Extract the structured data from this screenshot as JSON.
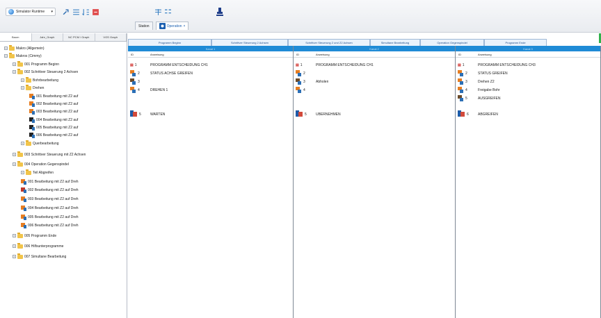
{
  "toolbar": {
    "dropdown_label": "Simulator Runtime",
    "top_tabs": [
      {
        "label": "Station",
        "active": false
      },
      {
        "label": "Operation",
        "active": true
      }
    ]
  },
  "left_panel": {
    "tabs": [
      "Baum",
      "Jahr_Graph",
      "NC PCM / Graph",
      "VGS Graph"
    ],
    "tree": [
      {
        "label": "Makro (Allgemein)",
        "level": 0,
        "icon": "folder"
      },
      {
        "label": "Makros (Cimmy)",
        "level": 0,
        "icon": "folder"
      },
      {
        "label": "001 Programm Beginn",
        "level": 1,
        "icon": "folder"
      },
      {
        "label": "002 Schrittver Steuerung 2 Achsen",
        "level": 1,
        "icon": "folder"
      },
      {
        "label": "Bohrbearbeitung",
        "level": 2,
        "icon": "folder"
      },
      {
        "label": "Drehen",
        "level": 2,
        "icon": "folder"
      },
      {
        "label": "001 Bearbeitung mit Z2 auf",
        "level": 3,
        "icon": "op"
      },
      {
        "label": "002 Bearbeitung mit Z2 auf",
        "level": 3,
        "icon": "op"
      },
      {
        "label": "003 Bearbeitung mit Z2 auf",
        "level": 3,
        "icon": "op"
      },
      {
        "label": "004 Bearbeitung mit Z2 auf",
        "level": 3,
        "icon": "op-black"
      },
      {
        "label": "005 Bearbeitung mit Z2 auf",
        "level": 3,
        "icon": "op-black"
      },
      {
        "label": "006 Bearbeitung mit Z2 auf",
        "level": 3,
        "icon": "op-black"
      },
      {
        "label": "Querbearbeitung",
        "level": 2,
        "icon": "folder"
      },
      {
        "label": "003 Schrittver Steuerung mit Z2 Achsen",
        "level": 1,
        "icon": "folder"
      },
      {
        "label": "004 Operation Gegenspindel",
        "level": 1,
        "icon": "folder"
      },
      {
        "label": "Teil Abgreifen",
        "level": 2,
        "icon": "folder"
      },
      {
        "label": "001 Bearbeitung mit Z2 auf Dreh",
        "level": 2,
        "icon": "op"
      },
      {
        "label": "002 Bearbeitung mit Z2 auf Dreh",
        "level": 2,
        "icon": "op-red"
      },
      {
        "label": "003 Bearbeitung mit Z2 auf Dreh",
        "level": 2,
        "icon": "op"
      },
      {
        "label": "004 Bearbeitung mit Z2 auf Dreh",
        "level": 2,
        "icon": "op"
      },
      {
        "label": "005 Bearbeitung mit Z2 auf Dreh",
        "level": 2,
        "icon": "op"
      },
      {
        "label": "006 Bearbeitung mit Z2 auf Dreh",
        "level": 2,
        "icon": "op"
      },
      {
        "label": "005 Programm Ende",
        "level": 1,
        "icon": "folder"
      },
      {
        "label": "006 Hilfsunterprogramme",
        "level": 1,
        "icon": "folder"
      },
      {
        "label": "007 Simultane Bearbeitung",
        "level": 1,
        "icon": "folder"
      }
    ]
  },
  "main": {
    "section_tabs": [
      "Programm Beginn",
      "Schrittver Steuerung 2 Achsen",
      "Schrittver Steuerung 2 und Z2 Achsen",
      "Simultane Bearbeitung",
      "Operation Gegenspindel",
      "Programm Ende"
    ],
    "columns": [
      {
        "title": "Kanal 1",
        "header_id": "ID",
        "header_text": "Anweisung",
        "rows": [
          {
            "id": "1",
            "icon": "prog",
            "text": "PROGRAMM ENTSCHEIDUNG CH1"
          },
          {
            "id": "2",
            "icon": "op",
            "text": "STATUS ACHSE GREIFEN"
          },
          {
            "id": "3",
            "icon": "op-dark",
            "text": ""
          },
          {
            "id": "4",
            "icon": "op",
            "text": "DREHEN 1"
          },
          {
            "id": "",
            "icon": "",
            "text": ""
          },
          {
            "id": "5",
            "icon": "op-big",
            "text": "WARTEN"
          }
        ]
      },
      {
        "title": "Kanal 2",
        "header_id": "ID",
        "header_text": "Anweisung",
        "rows": [
          {
            "id": "1",
            "icon": "prog",
            "text": "PROGRAMM ENTSCHEIDUNG CH1"
          },
          {
            "id": "2",
            "icon": "op",
            "text": ""
          },
          {
            "id": "3",
            "icon": "op-dark",
            "text": "Abholen"
          },
          {
            "id": "4",
            "icon": "op",
            "text": ""
          },
          {
            "id": "",
            "icon": "",
            "text": ""
          },
          {
            "id": "5",
            "icon": "op-big",
            "text": "ÜBERNEHMEN"
          }
        ]
      },
      {
        "title": "Kanal 3",
        "header_id": "ID",
        "header_text": "Anweisung",
        "rows": [
          {
            "id": "1",
            "icon": "prog",
            "text": "PROGRAMM ENTSCHEIDUNG CH3"
          },
          {
            "id": "2",
            "icon": "op",
            "text": "STATUS GREIFEN"
          },
          {
            "id": "3",
            "icon": "op",
            "text": "Drehen Z2"
          },
          {
            "id": "4",
            "icon": "op",
            "text": "Freigabe Bohr"
          },
          {
            "id": "5",
            "icon": "op-dark",
            "text": "AUSGREIFEN"
          },
          {
            "id": "6",
            "icon": "op-big",
            "text": "ABGREIFEN"
          }
        ]
      }
    ]
  },
  "colors": {
    "accent": "#1f8bd6",
    "folder": "#f1c44a"
  }
}
